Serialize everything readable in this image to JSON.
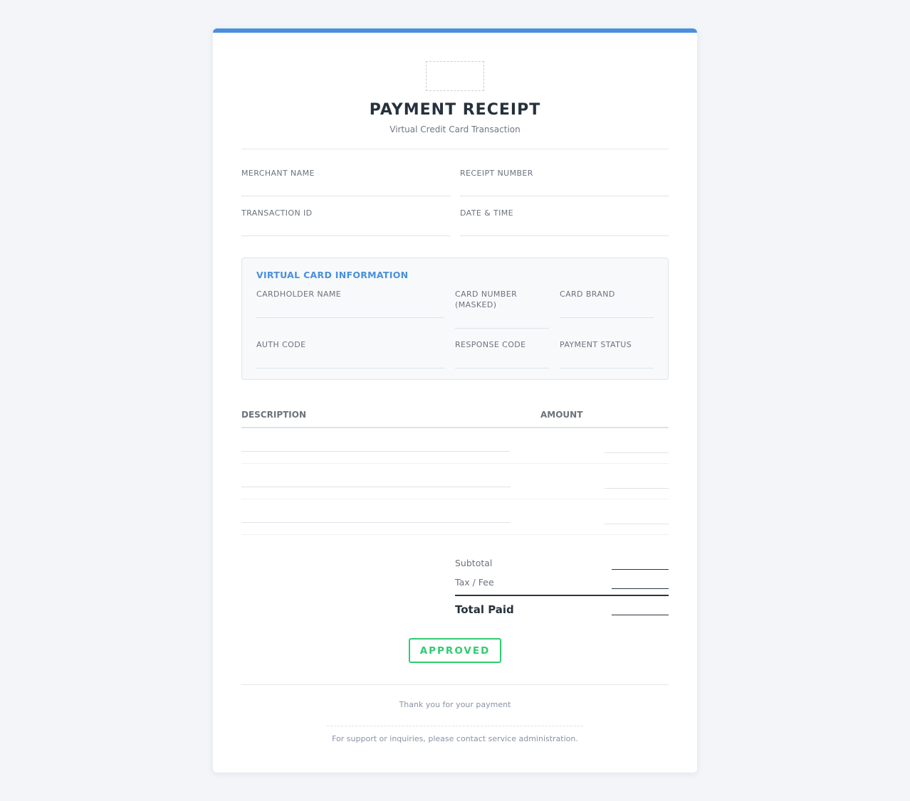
{
  "receipt": {
    "title": "PAYMENT RECEIPT",
    "subtitle": "Virtual Credit Card Transaction"
  },
  "fields": {
    "merchant_name": "MERCHANT NAME",
    "receipt_number": "RECEIPT NUMBER",
    "transaction_id": "TRANSACTION ID",
    "date_time": "DATE & TIME"
  },
  "virtual_card": {
    "title": "VIRTUAL CARD INFORMATION",
    "cardholder_name": "CARDHOLDER NAME",
    "card_number_line1": "CARD NUMBER",
    "card_number_line2": "(MASKED)",
    "card_brand": "CARD BRAND",
    "auth_code": "AUTH CODE",
    "response_code": "RESPONSE CODE",
    "payment_status": "PAYMENT STATUS"
  },
  "table": {
    "headers": [
      "DESCRIPTION",
      "AMOUNT"
    ]
  },
  "summary": {
    "subtotal": "Subtotal",
    "tax_fee": "Tax / Fee",
    "total_paid": "Total Paid"
  },
  "status_badge": "APPROVED",
  "footer": {
    "thanks": "Thank you for your payment",
    "support": "For support or inquiries, please contact service administration."
  },
  "colors": {
    "accent": "#4a8fde",
    "approved": "#2ecc71"
  }
}
